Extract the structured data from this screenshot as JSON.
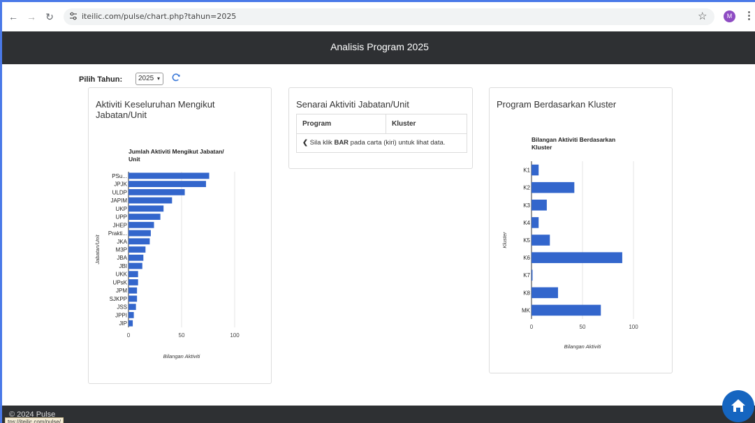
{
  "browser": {
    "url": "iteilic.com/pulse/chart.php?tahun=2025",
    "avatar_initial": "M",
    "status_url": "tps://iteilic.com/pulse/"
  },
  "header": {
    "title": "Analisis Program 2025"
  },
  "filter": {
    "label": "Pilih Tahun:",
    "selected_year": "2025"
  },
  "card_left": {
    "title": "Aktiviti Keseluruhan Mengikut Jabatan/Unit"
  },
  "card_middle": {
    "title": "Senarai Aktiviti Jabatan/Unit",
    "columns": [
      "Program",
      "Kluster"
    ],
    "empty_message_pre": "Sila klik ",
    "empty_message_bold": "BAR",
    "empty_message_post": " pada carta (kiri) untuk lihat data."
  },
  "card_right": {
    "title": "Program Berdasarkan Kluster"
  },
  "footer": {
    "text": "© 2024 Pulse"
  },
  "colors": {
    "bar": "#3366cc",
    "header_bg": "#2e3033",
    "fab": "#1565c0"
  },
  "chart_data": [
    {
      "type": "bar",
      "orientation": "horizontal",
      "title": "Jumlah Aktiviti Mengikut Jabatan/ Unit",
      "xlabel": "Bilangan Aktiviti",
      "ylabel": "Jabatan/Unit",
      "categories": [
        "PSu...",
        "JPJK",
        "ULDP",
        "JAPIM",
        "UKP",
        "UPP",
        "JHEP",
        "Prakti...",
        "JKA",
        "M3P",
        "JBA",
        "JBI",
        "UKK",
        "UPsK",
        "JPM",
        "SJKPP",
        "JSS",
        "JPPI",
        "JIP"
      ],
      "values": [
        76,
        73,
        53,
        41,
        33,
        30,
        24,
        21,
        20,
        16,
        14,
        13,
        9,
        9,
        8,
        8,
        7,
        5,
        4
      ],
      "xlim": [
        0,
        100
      ],
      "xticks": [
        0,
        50,
        100
      ],
      "grid": true
    },
    {
      "type": "bar",
      "orientation": "horizontal",
      "title": "Bilangan Aktiviti Berdasarkan Kluster",
      "xlabel": "Bilangan Aktiviti",
      "ylabel": "Kluster",
      "categories": [
        "K1",
        "K2",
        "K3",
        "K4",
        "K5",
        "K6",
        "K7",
        "K8",
        "MK"
      ],
      "values": [
        7,
        42,
        15,
        7,
        18,
        89,
        1,
        26,
        68
      ],
      "xlim": [
        0,
        100
      ],
      "xticks": [
        0,
        50,
        100
      ],
      "grid": true
    }
  ]
}
